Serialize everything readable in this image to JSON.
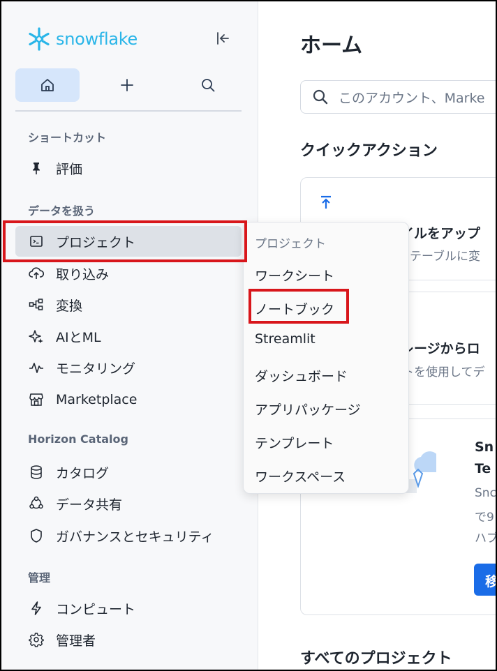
{
  "brand": {
    "name": "snowflake",
    "color": "#29b5e8"
  },
  "sidebar": {
    "collapse_icon": "collapse-left-icon",
    "top_buttons": [
      {
        "name": "home",
        "icon": "home-icon"
      },
      {
        "name": "create",
        "icon": "plus-icon"
      },
      {
        "name": "search",
        "icon": "search-icon"
      }
    ],
    "sections": {
      "shortcuts": "ショートカット",
      "work_with_data": "データを扱う",
      "horizon": "Horizon Catalog",
      "admin": "管理"
    },
    "items": {
      "evaluation": "評価",
      "projects": "プロジェクト",
      "ingestion": "取り込み",
      "transform": "変換",
      "ai_ml": "AIとML",
      "monitoring": "モニタリング",
      "marketplace": "Marketplace",
      "catalog": "カタログ",
      "data_sharing": "データ共有",
      "governance": "ガバナンスとセキュリティ",
      "compute": "コンピュート",
      "administrator": "管理者"
    }
  },
  "main": {
    "title": "ホーム",
    "search_placeholder": "このアカウント、Marke",
    "quick_actions": "クイックアクション",
    "card1_title": "イルをアップ",
    "card1_sub": "くテーブルに変",
    "card2_title": "レージからロ",
    "card2_sub": "トを使用してデ",
    "card3_title_a": "Sn",
    "card3_title_b": "Te",
    "card3_sub_a": "Snc",
    "card3_sub_b": "で9",
    "card3_sub_c": "ハブ",
    "card3_btn": "移",
    "all_projects": "すべてのプロジェクト"
  },
  "menu": {
    "header": "プロジェクト",
    "items": [
      "ワークシート",
      "ノートブック",
      "Streamlit",
      "ダッシュボード",
      "アプリパッケージ",
      "テンプレート",
      "ワークスペース"
    ]
  },
  "highlight_color": "#d8161b"
}
